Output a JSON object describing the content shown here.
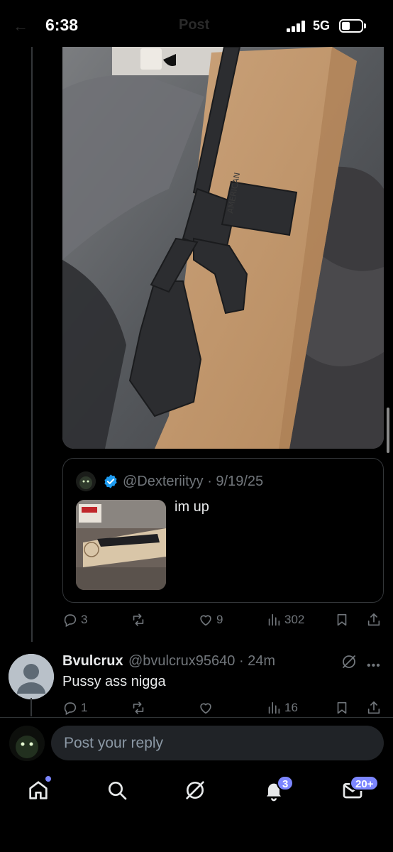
{
  "status_bar": {
    "time": "6:38",
    "network": "5G",
    "ghost_title": "Post",
    "icons": [
      "signal-icon",
      "battery-icon"
    ]
  },
  "main_post": {
    "media_description_icon": "photo-media",
    "quote": {
      "handle_date": "@Dexteriityy · 9/19/25",
      "text": "im up",
      "verified": true,
      "verified_color": "#1d9bf0"
    },
    "stats": {
      "replies": "3",
      "reposts": "",
      "likes": "9",
      "views": "302"
    }
  },
  "reply": {
    "name": "Bvulcrux",
    "handle_time": "@bvulcrux95640 · 24m",
    "text": "Pussy ass nigga",
    "stats": {
      "replies": "1",
      "reposts": "",
      "likes": "",
      "views": "16"
    }
  },
  "compose": {
    "placeholder": "Post your reply"
  },
  "nav": {
    "notifications_badge": "3",
    "messages_badge": "20+",
    "accent": "#7c86ff"
  },
  "colors": {
    "background": "#000000",
    "secondary_text": "#71767b",
    "primary_text": "#e7e9ea"
  }
}
